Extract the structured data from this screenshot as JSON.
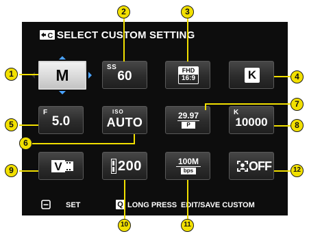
{
  "header": {
    "title": "SELECT CUSTOM SETTING",
    "icon": "custom-setting-icon"
  },
  "tiles": {
    "mode": {
      "value": "M"
    },
    "shutter": {
      "label": "SS",
      "value": "60"
    },
    "movie_mode": {
      "line1": "FHD",
      "line2": "16:9"
    },
    "k_key": {
      "value": "K"
    },
    "aperture": {
      "label": "F",
      "value": "5.0"
    },
    "iso": {
      "label": "ISO",
      "value": "AUTO"
    },
    "frame_rate": {
      "value": "29.97",
      "sub": "P"
    },
    "white_balance": {
      "label": "K",
      "value": "10000"
    },
    "film_sim": {
      "value": "V"
    },
    "dynamic_range": {
      "value": "200"
    },
    "bitrate": {
      "value": "100M",
      "sub": "bps"
    },
    "face_detect": {
      "value": "OFF"
    }
  },
  "footer": {
    "set_label": "SET",
    "set_key": "Q",
    "long_press": "LONG PRESS",
    "edit_label": "EDIT/SAVE CUSTOM"
  },
  "callouts": [
    "1",
    "2",
    "3",
    "4",
    "5",
    "6",
    "7",
    "8",
    "9",
    "10",
    "11",
    "12"
  ],
  "colors": {
    "callout": "#f2e000",
    "arrow": "#4aa3ff",
    "screen": "#0d0d0d"
  }
}
